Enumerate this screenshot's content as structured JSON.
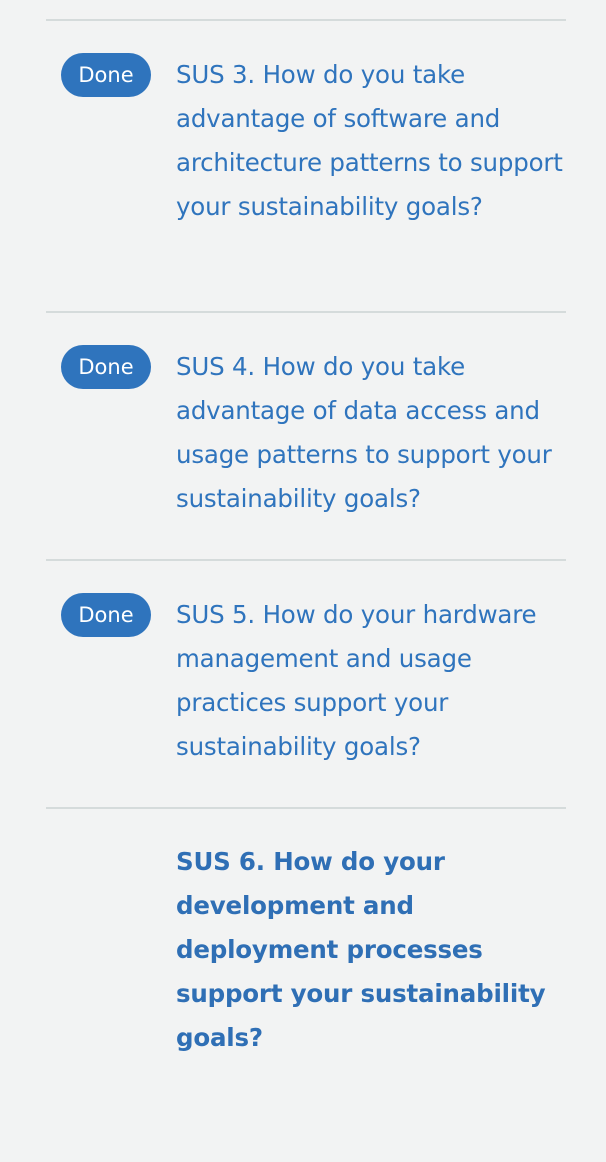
{
  "questions": [
    {
      "status": "Done",
      "label": "SUS 3. How do you take advantage of software and architecture patterns to support your sustainability goals?"
    },
    {
      "status": "Done",
      "label": "SUS 4. How do you take advantage of data access and usage patterns to support your sustainability goals?"
    },
    {
      "status": "Done",
      "label": "SUS 5. How do your hardware management and usage practices support your sustainability goals?"
    },
    {
      "status": "",
      "label": "SUS 6. How do your development and deployment processes support your sustainability goals?",
      "current": true
    }
  ],
  "colors": {
    "background": "#f2f3f3",
    "link": "#2f74bd",
    "badge_bg": "#2f74bd",
    "badge_text": "#ffffff",
    "divider": "#d5dbdb"
  }
}
